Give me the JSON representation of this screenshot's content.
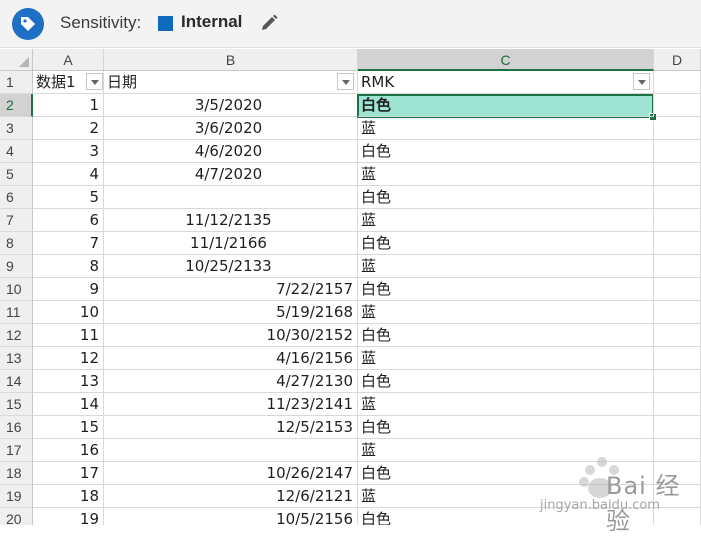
{
  "sensitivity": {
    "label": "Sensitivity:",
    "value": "Internal",
    "swatch_color": "#0f6cbd",
    "badge_icon": "tag-icon",
    "edit_icon": "pencil-icon"
  },
  "columns": [
    "A",
    "B",
    "C",
    "D"
  ],
  "header_row": {
    "row_number": "1",
    "a": "数据1",
    "b": "日期",
    "c": "RMK"
  },
  "rows": [
    {
      "n": "2",
      "a": "1",
      "b": "3/5/2020",
      "c": "白色"
    },
    {
      "n": "3",
      "a": "2",
      "b": "3/6/2020",
      "c": "蓝"
    },
    {
      "n": "4",
      "a": "3",
      "b": "4/6/2020",
      "c": "白色"
    },
    {
      "n": "5",
      "a": "4",
      "b": "4/7/2020",
      "c": "蓝"
    },
    {
      "n": "6",
      "a": "5",
      "b": "",
      "c": "白色"
    },
    {
      "n": "7",
      "a": "6",
      "b": "11/12/2135",
      "c": "蓝"
    },
    {
      "n": "8",
      "a": "7",
      "b": "11/1/2166",
      "c": "白色"
    },
    {
      "n": "9",
      "a": "8",
      "b": "10/25/2133",
      "c": "蓝"
    },
    {
      "n": "10",
      "a": "9",
      "b": "7/22/2157",
      "c": "白色"
    },
    {
      "n": "11",
      "a": "10",
      "b": "5/19/2168",
      "c": "蓝"
    },
    {
      "n": "12",
      "a": "11",
      "b": "10/30/2152",
      "c": "白色"
    },
    {
      "n": "13",
      "a": "12",
      "b": "4/16/2156",
      "c": "蓝"
    },
    {
      "n": "14",
      "a": "13",
      "b": "4/27/2130",
      "c": "白色"
    },
    {
      "n": "15",
      "a": "14",
      "b": "11/23/2141",
      "c": "蓝"
    },
    {
      "n": "16",
      "a": "15",
      "b": "12/5/2153",
      "c": "白色"
    },
    {
      "n": "17",
      "a": "16",
      "b": "",
      "c": "蓝"
    },
    {
      "n": "18",
      "a": "17",
      "b": "10/26/2147",
      "c": "白色"
    },
    {
      "n": "19",
      "a": "18",
      "b": "12/6/2121",
      "c": "蓝"
    },
    {
      "n": "20",
      "a": "19",
      "b": "10/5/2156",
      "c": "白色"
    }
  ],
  "watermark": {
    "brand": "Bai 经验",
    "url": "jingyan.baidu.com"
  },
  "colors": {
    "active_fill": "#9fe3d2",
    "selection_border": "#1e7145"
  }
}
